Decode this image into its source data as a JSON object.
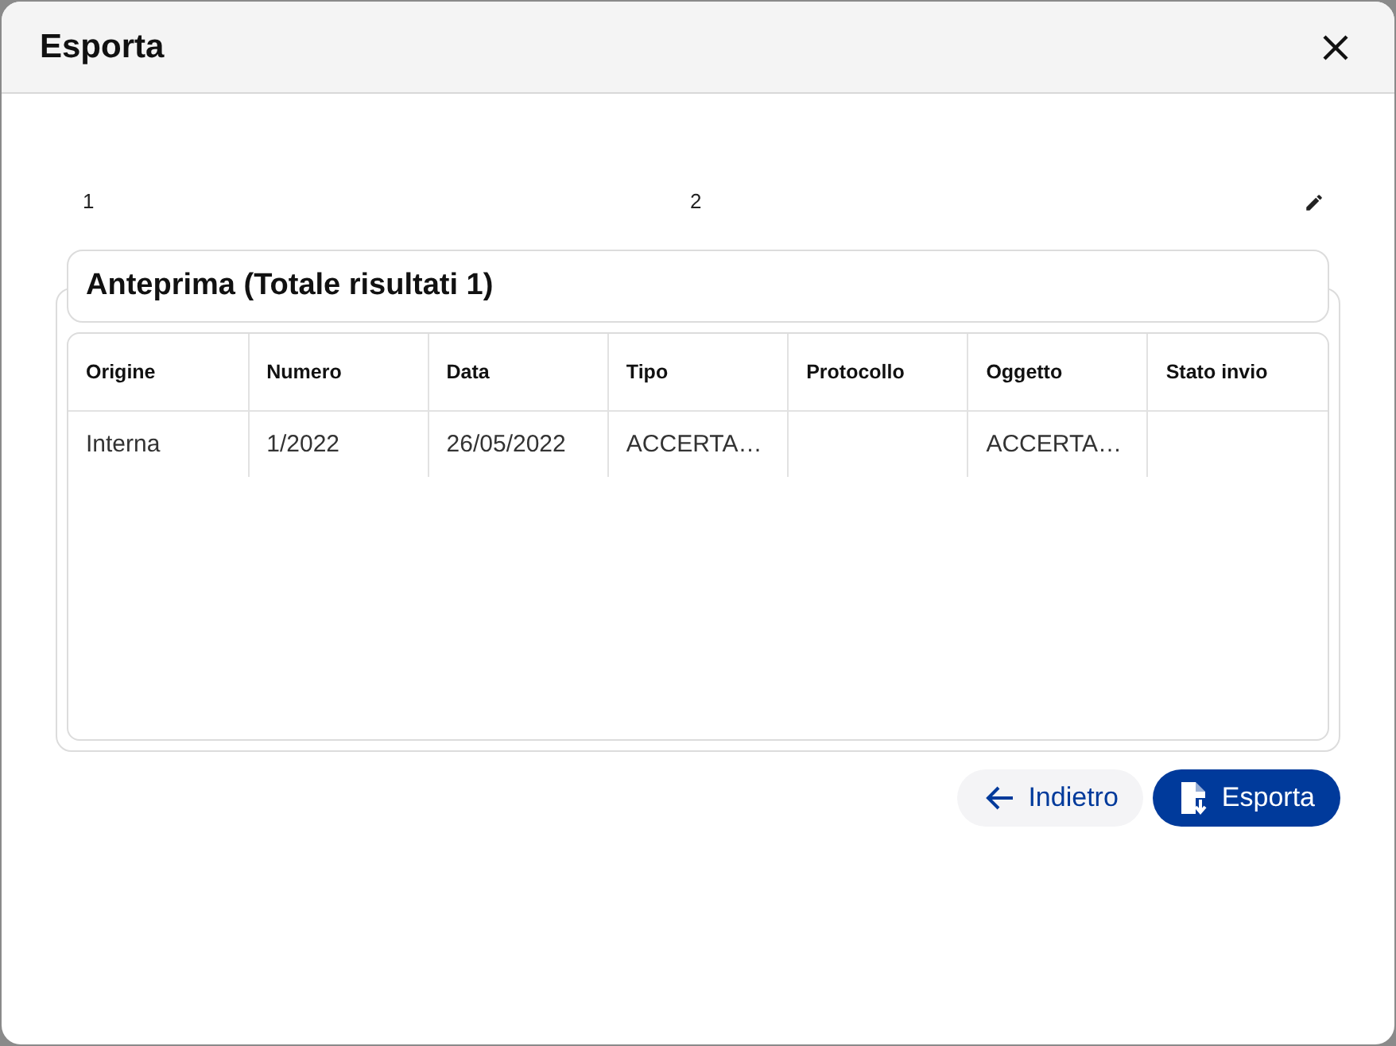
{
  "dialog": {
    "title": "Esporta"
  },
  "steps": [
    {
      "label": "1"
    },
    {
      "label": "2"
    }
  ],
  "preview": {
    "title": "Anteprima (Totale risultati 1)",
    "columns": [
      "Origine",
      "Numero",
      "Data",
      "Tipo",
      "Protocollo",
      "Oggetto",
      "Stato invio"
    ],
    "rows": [
      [
        "Interna",
        "1/2022",
        "26/05/2022",
        "ACCERTA…",
        "",
        "ACCERTA…",
        ""
      ]
    ]
  },
  "buttons": [
    {
      "label": "Indietro",
      "kind": "back"
    },
    {
      "label": "Esporta",
      "kind": "export"
    }
  ]
}
